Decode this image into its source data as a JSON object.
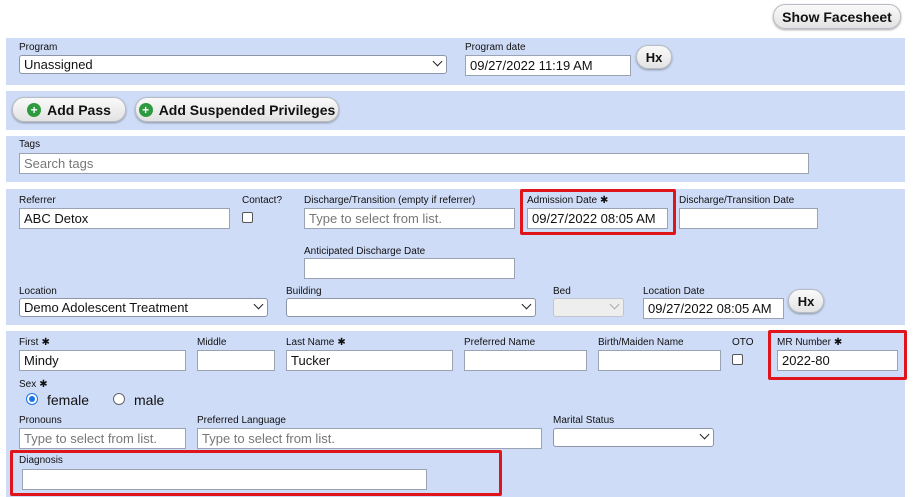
{
  "header": {
    "show_facesheet_label": "Show Facesheet"
  },
  "program": {
    "program_label": "Program",
    "program_value": "Unassigned",
    "program_date_label": "Program date",
    "program_date_value": "09/27/2022 11:19 AM",
    "hx_label": "Hx"
  },
  "actions": {
    "add_pass_label": "Add Pass",
    "add_suspended_label": "Add Suspended Privileges"
  },
  "tags": {
    "label": "Tags",
    "placeholder": "Search tags"
  },
  "admission": {
    "referrer_label": "Referrer",
    "referrer_value": "ABC Detox",
    "contact_label": "Contact?",
    "discharge_transition_label": "Discharge/Transition (empty if referrer)",
    "discharge_transition_placeholder": "Type to select from list.",
    "admission_date_label": "Admission Date",
    "admission_date_value": "09/27/2022 08:05 AM",
    "discharge_date_label": "Discharge/Transition Date",
    "discharge_date_value": "",
    "anticipated_label": "Anticipated Discharge Date",
    "anticipated_value": "",
    "location_label": "Location",
    "location_value": "Demo Adolescent Treatment",
    "building_label": "Building",
    "building_value": "",
    "bed_label": "Bed",
    "bed_value": "",
    "location_date_label": "Location Date",
    "location_date_value": "09/27/2022 08:05 AM",
    "hx_label": "Hx"
  },
  "client": {
    "first_label": "First",
    "first_value": "Mindy",
    "middle_label": "Middle",
    "middle_value": "",
    "last_label": "Last Name",
    "last_value": "Tucker",
    "preferred_label": "Preferred Name",
    "preferred_value": "",
    "birth_label": "Birth/Maiden Name",
    "birth_value": "",
    "oto_label": "OTO",
    "mr_label": "MR Number",
    "mr_value": "2022-80",
    "sex_label": "Sex",
    "sex_options": [
      "female",
      "male"
    ],
    "sex_selected": "female",
    "pronouns_label": "Pronouns",
    "pronouns_placeholder": "Type to select from list.",
    "language_label": "Preferred Language",
    "language_placeholder": "Type to select from list.",
    "marital_label": "Marital Status",
    "marital_value": "",
    "diagnosis_label": "Diagnosis",
    "diagnosis_value": ""
  },
  "required_marker": "✱",
  "colors": {
    "panel": "#cfdcf7",
    "highlight": "#e0141b",
    "accent": "#1a73e8",
    "plus_icon": "#2e9a3e"
  }
}
